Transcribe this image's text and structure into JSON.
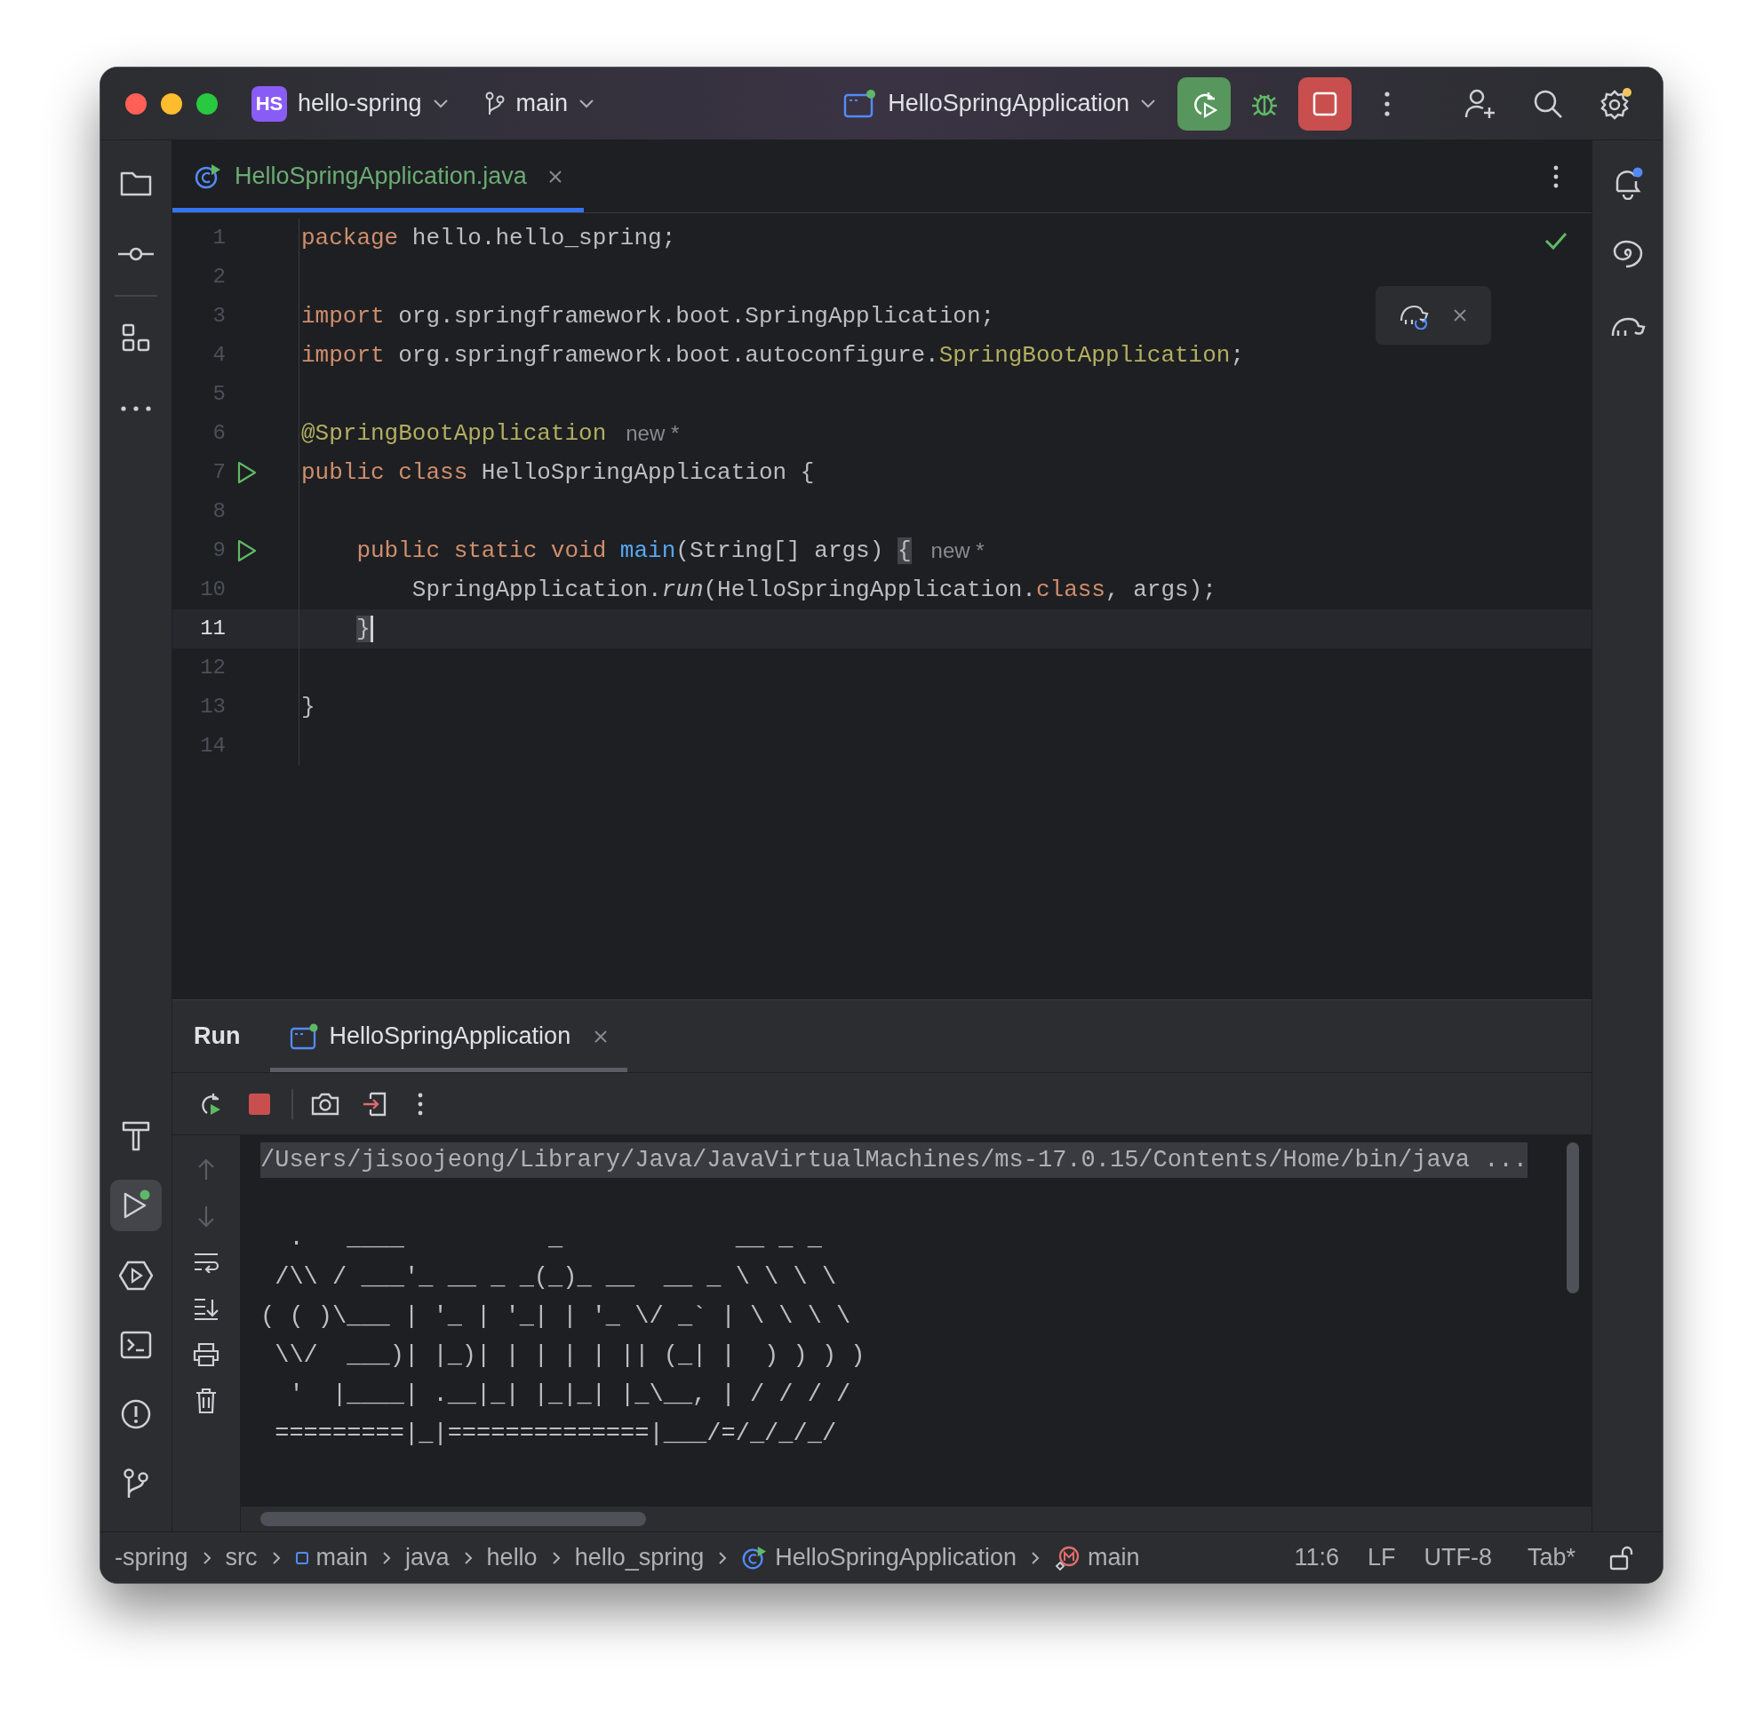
{
  "toolbar": {
    "project_badge": "HS",
    "project": "hello-spring",
    "branch": "main",
    "run_config": "HelloSpringApplication"
  },
  "editor_tabs": [
    {
      "label": "HelloSpringApplication.java",
      "selected": true
    }
  ],
  "code_lines": [
    {
      "number": "1",
      "current": false,
      "runnable": false,
      "tokens": [
        {
          "text": "package",
          "kind": "kw"
        },
        {
          "text": " hello.hello_spring;",
          "kind": "plain"
        }
      ]
    },
    {
      "number": "2",
      "current": false,
      "runnable": false
    },
    {
      "number": "3",
      "current": false,
      "runnable": false,
      "tokens": [
        {
          "text": "import",
          "kind": "kw"
        },
        {
          "text": " org.springframework.boot.SpringApplication;",
          "kind": "plain"
        }
      ]
    },
    {
      "number": "4",
      "current": false,
      "runnable": false,
      "tokens": [
        {
          "text": "import",
          "kind": "kw"
        },
        {
          "text": " org.springframework.boot.autoconfigure.",
          "kind": "plain"
        },
        {
          "text": "SpringBootApplication",
          "kind": "ann"
        },
        {
          "text": ";",
          "kind": "plain"
        }
      ]
    },
    {
      "number": "5",
      "current": false,
      "runnable": false
    },
    {
      "number": "6",
      "current": false,
      "runnable": false,
      "tokens": [
        {
          "text": "@SpringBootApplication",
          "kind": "ann"
        },
        {
          "text": "new *",
          "kind": "hint"
        }
      ]
    },
    {
      "number": "7",
      "current": false,
      "runnable": true,
      "tokens": [
        {
          "text": "public class",
          "kind": "kw"
        },
        {
          "text": " HelloSpringApplication {",
          "kind": "plain"
        }
      ]
    },
    {
      "number": "8",
      "current": false,
      "runnable": false
    },
    {
      "number": "9",
      "current": false,
      "runnable": true,
      "tokens": [
        {
          "text": "    public static void ",
          "kind": "kw"
        },
        {
          "text": "main",
          "kind": "fn"
        },
        {
          "text": "(String[] args) ",
          "kind": "plain"
        },
        {
          "text": "{",
          "kind": "match"
        },
        {
          "text": "new *",
          "kind": "hint"
        }
      ]
    },
    {
      "number": "10",
      "current": false,
      "runnable": false,
      "tokens": [
        {
          "text": "        SpringApplication.",
          "kind": "plain"
        },
        {
          "text": "run",
          "kind": "italic"
        },
        {
          "text": "(HelloSpringApplication.",
          "kind": "plain"
        },
        {
          "text": "class",
          "kind": "kw"
        },
        {
          "text": ", args);",
          "kind": "plain"
        }
      ]
    },
    {
      "number": "11",
      "current": true,
      "runnable": false,
      "in_method": true,
      "tokens": [
        {
          "text": "}",
          "kind": "match"
        }
      ]
    },
    {
      "number": "12",
      "current": false,
      "runnable": false
    },
    {
      "number": "13",
      "current": false,
      "runnable": false,
      "tokens": [
        {
          "text": "}",
          "kind": "plain"
        }
      ]
    },
    {
      "number": "14",
      "current": false,
      "runnable": false
    }
  ],
  "run_panel": {
    "title": "Run",
    "tabs": [
      {
        "label": "HelloSpringApplication",
        "selected": true
      }
    ],
    "console_lines": [
      {
        "text": "/Users/jisoojeong/Library/Java/JavaVirtualMachines/ms-17.0.15/Contents/Home/bin/java ...",
        "kind": "command"
      },
      {
        "kind": "blank"
      },
      {
        "text": "  .   ____          _            __ _ _",
        "kind": "output"
      },
      {
        "text": " /\\\\ / ___'_ __ _ _(_)_ __  __ _ \\ \\ \\ \\",
        "kind": "output"
      },
      {
        "text": "( ( )\\___ | '_ | '_| | '_ \\/ _` | \\ \\ \\ \\",
        "kind": "output"
      },
      {
        "text": " \\\\/  ___)| |_)| | | | | || (_| |  ) ) ) )",
        "kind": "output"
      },
      {
        "text": "  '  |____| .__|_| |_|_| |_\\__, | / / / /",
        "kind": "output"
      },
      {
        "text": " =========|_|==============|___/=/_/_/_/",
        "kind": "output"
      }
    ]
  },
  "status_bar": {
    "breadcrumbs": [
      {
        "label": "-spring",
        "kind": "plain"
      },
      {
        "label": "src",
        "kind": "plain"
      },
      {
        "label": "main",
        "kind": "module"
      },
      {
        "label": "java",
        "kind": "plain"
      },
      {
        "label": "hello",
        "kind": "plain"
      },
      {
        "label": "hello_spring",
        "kind": "plain"
      },
      {
        "label": "HelloSpringApplication",
        "kind": "class"
      },
      {
        "label": "main",
        "kind": "method"
      }
    ],
    "position": "11:6",
    "line_separator": "LF",
    "encoding": "UTF-8",
    "indent": "Tab*"
  }
}
